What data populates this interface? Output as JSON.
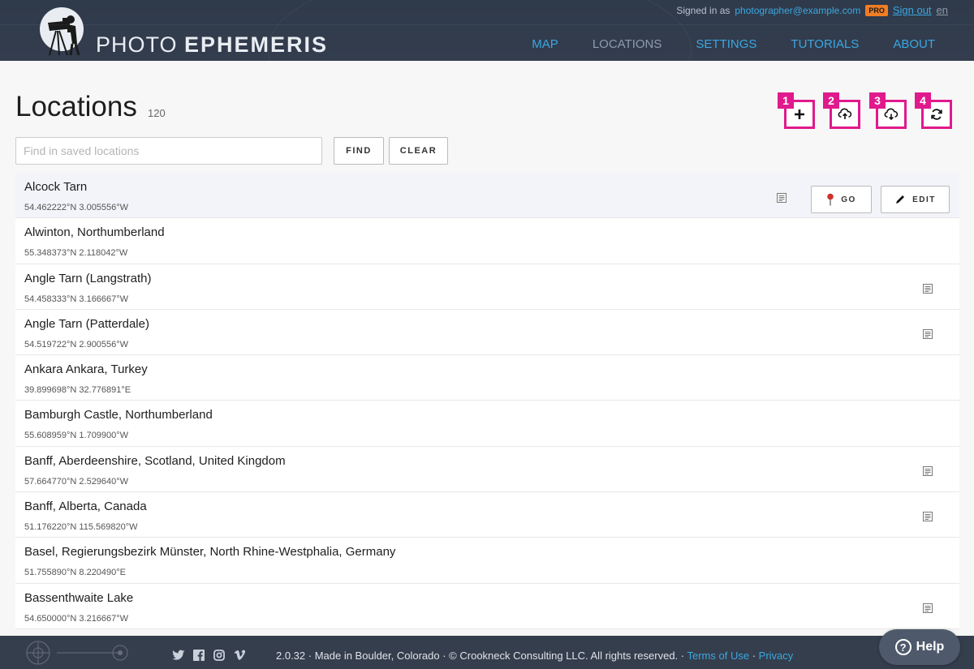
{
  "header": {
    "brand_light": "PHOTO",
    "brand_bold": "EPHEMERIS",
    "signed_in_label": "Signed in as",
    "email": "photographer@example.com",
    "pro_badge": "PRO",
    "sign_out": "Sign out",
    "language": "en",
    "nav": [
      {
        "label": "MAP",
        "active": false
      },
      {
        "label": "LOCATIONS",
        "active": true
      },
      {
        "label": "SETTINGS",
        "active": false
      },
      {
        "label": "TUTORIALS",
        "active": false
      },
      {
        "label": "ABOUT",
        "active": false
      }
    ]
  },
  "main": {
    "title": "Locations",
    "count": "120",
    "toolbar": [
      {
        "number": "1",
        "icon": "plus-icon"
      },
      {
        "number": "2",
        "icon": "cloud-upload-icon"
      },
      {
        "number": "3",
        "icon": "cloud-download-icon"
      },
      {
        "number": "4",
        "icon": "refresh-icon"
      }
    ],
    "search": {
      "placeholder": "Find in saved locations",
      "value": ""
    },
    "find_label": "FIND",
    "clear_label": "CLEAR",
    "go_label": "GO",
    "edit_label": "EDIT"
  },
  "locations": [
    {
      "name": "Alcock Tarn",
      "coords": "54.462222°N 3.005556°W",
      "has_note": true,
      "selected": true
    },
    {
      "name": "Alwinton, Northumberland",
      "coords": "55.348373°N 2.118042°W",
      "has_note": false,
      "selected": false
    },
    {
      "name": "Angle Tarn (Langstrath)",
      "coords": "54.458333°N 3.166667°W",
      "has_note": true,
      "selected": false
    },
    {
      "name": "Angle Tarn (Patterdale)",
      "coords": "54.519722°N 2.900556°W",
      "has_note": true,
      "selected": false
    },
    {
      "name": "Ankara Ankara, Turkey",
      "coords": "39.899698°N 32.776891°E",
      "has_note": false,
      "selected": false
    },
    {
      "name": "Bamburgh Castle, Northumberland",
      "coords": "55.608959°N 1.709900°W",
      "has_note": false,
      "selected": false
    },
    {
      "name": "Banff, Aberdeenshire, Scotland, United Kingdom",
      "coords": "57.664770°N 2.529640°W",
      "has_note": true,
      "selected": false
    },
    {
      "name": "Banff, Alberta, Canada",
      "coords": "51.176220°N 115.569820°W",
      "has_note": true,
      "selected": false
    },
    {
      "name": "Basel, Regierungsbezirk Münster, North Rhine-Westphalia, Germany",
      "coords": "51.755890°N 8.220490°E",
      "has_note": false,
      "selected": false
    },
    {
      "name": "Bassenthwaite Lake",
      "coords": "54.650000°N 3.216667°W",
      "has_note": true,
      "selected": false
    }
  ],
  "footer": {
    "social": [
      "twitter-icon",
      "facebook-icon",
      "instagram-icon",
      "vimeo-icon"
    ],
    "text": "2.0.32 · Made in Boulder, Colorado · © Crookneck Consulting LLC. All rights reserved. ·",
    "terms": "Terms of Use",
    "separator": "·",
    "privacy": "Privacy",
    "help_label": "Help"
  },
  "colors": {
    "header_bg": "#333d4e",
    "accent_blue": "#3ba7e1",
    "pro_orange": "#f07d24",
    "annotation_magenta": "#e0198c",
    "footer_bg": "#353e4d"
  }
}
